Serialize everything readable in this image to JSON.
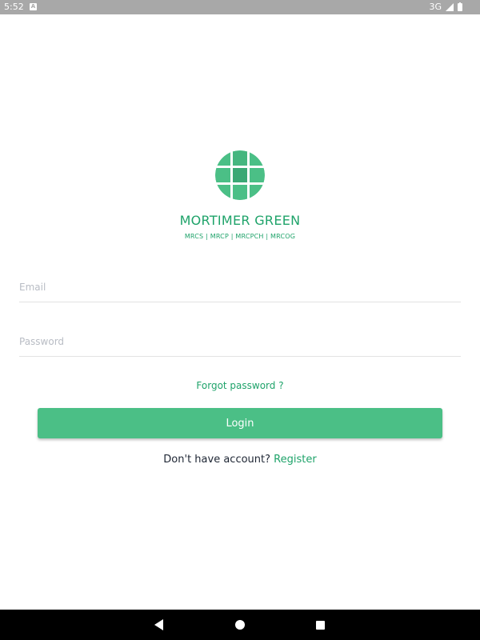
{
  "status_bar": {
    "time": "5:52",
    "notification_icon": "a-notification-icon",
    "network": "3G",
    "signal_icon": "signal-icon",
    "battery_icon": "battery-icon"
  },
  "brand": {
    "logo_icon": "globe-grid-logo",
    "name": "MORTIMER GREEN",
    "tagline": "MRCS | MRCP | MRCPCH | MRCOG",
    "color": "#1fa36a",
    "logo_color": "#4bbf86"
  },
  "form": {
    "email_placeholder": "Email",
    "email_value": "",
    "password_placeholder": "Password",
    "password_value": "",
    "forgot_password": "Forgot password ?",
    "login_label": "Login",
    "no_account_text": "Don't have account?",
    "register_label": "Register"
  },
  "nav_bar": {
    "back_icon": "back-triangle-icon",
    "home_icon": "home-circle-icon",
    "recents_icon": "recents-square-icon"
  }
}
